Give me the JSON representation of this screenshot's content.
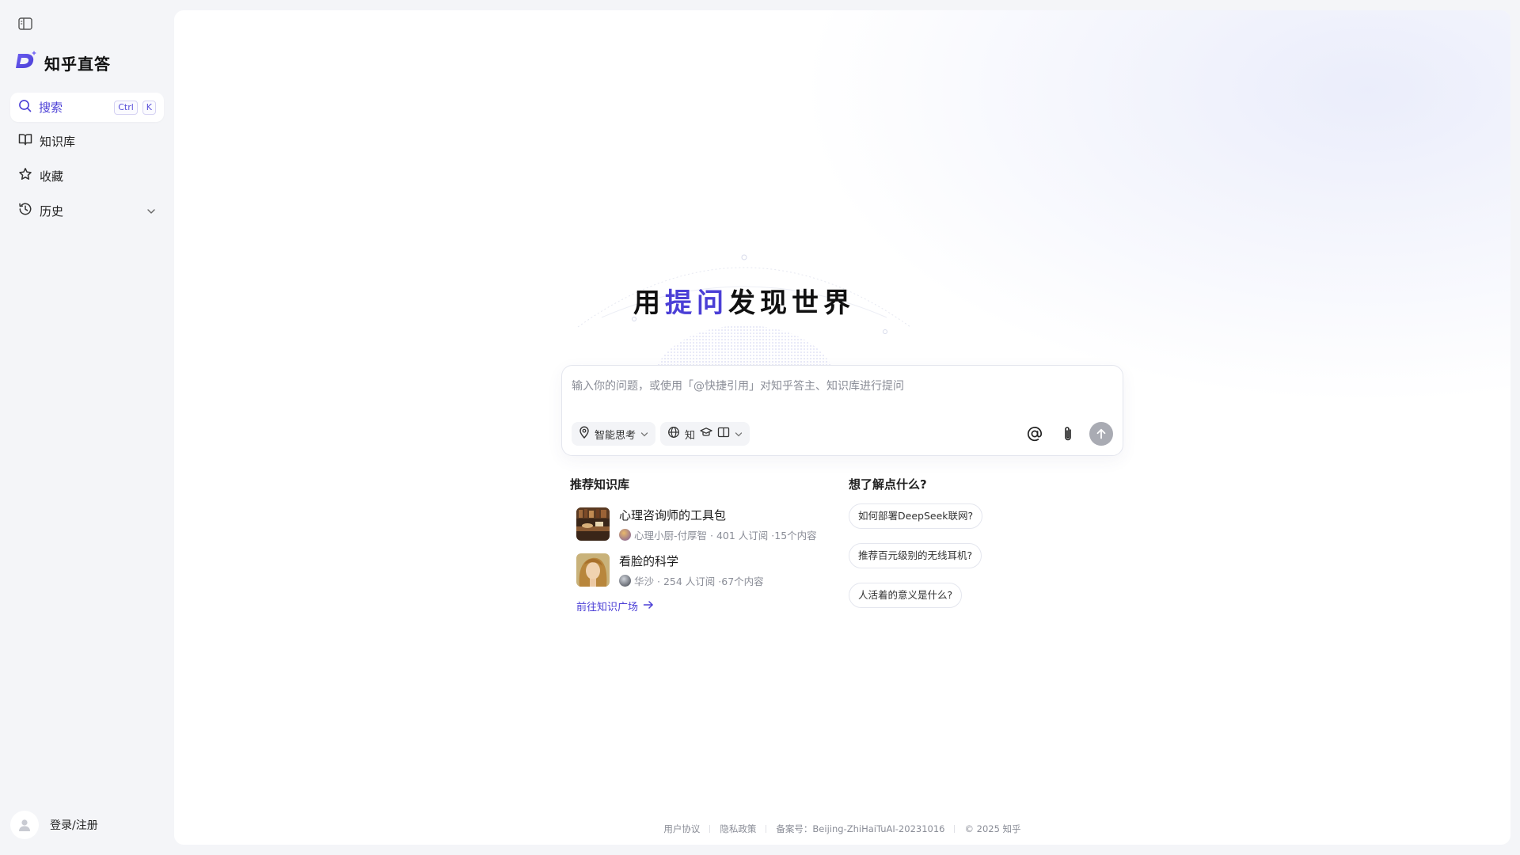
{
  "sidebar": {
    "brand_name": "知乎直答",
    "search": {
      "label": "搜索",
      "shortcut_ctrl": "Ctrl",
      "shortcut_key": "K"
    },
    "items": [
      {
        "label": "知识库",
        "icon": "book-icon"
      },
      {
        "label": "收藏",
        "icon": "star-icon"
      },
      {
        "label": "历史",
        "icon": "clock-icon"
      }
    ],
    "login_label": "登录/注册"
  },
  "hero": {
    "title_prefix": "用",
    "title_accent": "提问",
    "title_suffix": "发现世界"
  },
  "composer": {
    "placeholder": "输入你的问题，或使用「@快捷引用」对知乎答主、知识库进行提问",
    "mode_label": "智能思考",
    "source_label": "知"
  },
  "recommend": {
    "title": "推荐知识库",
    "items": [
      {
        "title": "心理咨询师的工具包",
        "author": "心理小厨-付厚智",
        "meta": "· 401 人订阅 ·15个内容"
      },
      {
        "title": "看脸的科学",
        "author": "华沙",
        "meta": "· 254 人订阅 ·67个内容"
      }
    ],
    "link_label": "前往知识广场"
  },
  "ask": {
    "title": "想了解点什么?",
    "questions": [
      "如何部署DeepSeek联网?",
      "推荐百元级别的无线耳机?",
      "人活着的意义是什么?"
    ]
  },
  "footer": {
    "terms": "用户协议",
    "privacy": "隐私政策",
    "icp": "备案号：Beijing-ZhiHaiTuAI-20231016",
    "copyright": "© 2025 知乎"
  },
  "colors": {
    "accent": "#4b3fd6",
    "background": "#f4f5f8",
    "send_disabled": "#a9abb3"
  }
}
